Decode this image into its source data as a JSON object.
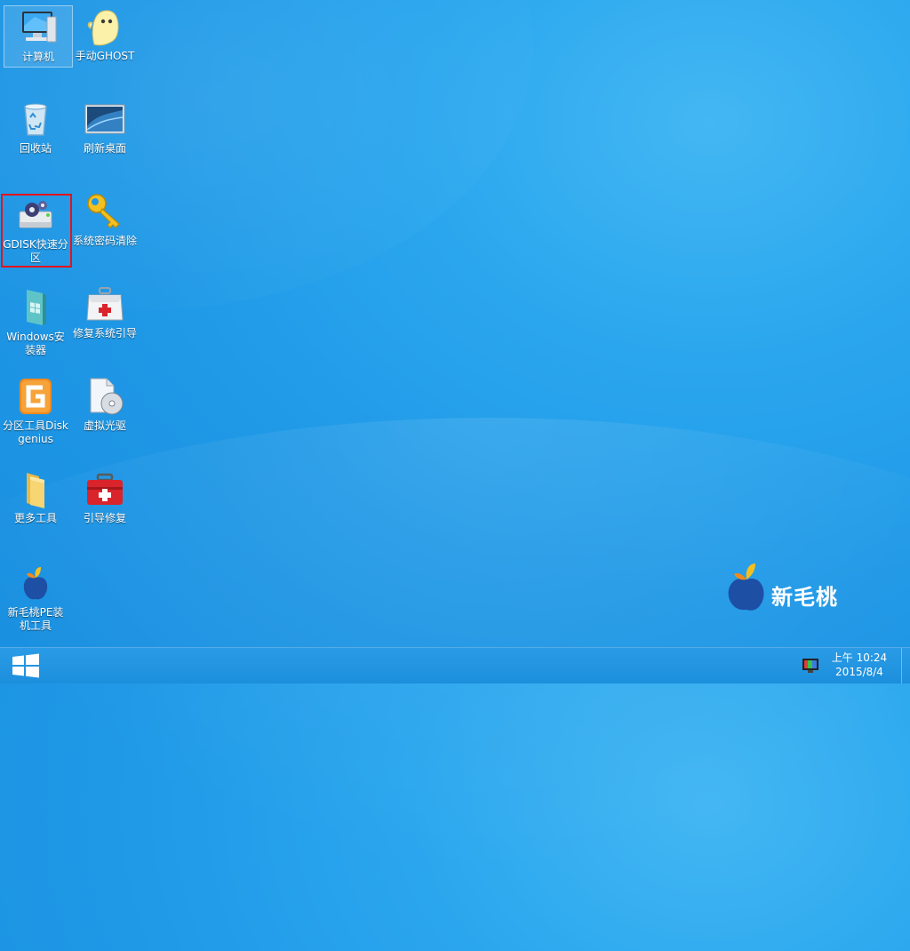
{
  "desktop": {
    "icons": [
      {
        "label": "计算机",
        "icon": "computer-icon"
      },
      {
        "label": "手动GHOST",
        "icon": "ghost-icon"
      },
      {
        "label": "回收站",
        "icon": "recycle-bin-icon"
      },
      {
        "label": "刷新桌面",
        "icon": "refresh-desktop-icon"
      },
      {
        "label": "GDISK快速分区",
        "icon": "gdisk-icon"
      },
      {
        "label": "系统密码清除",
        "icon": "key-icon"
      },
      {
        "label": "Windows安装器",
        "icon": "windows-installer-icon"
      },
      {
        "label": "修复系统引导",
        "icon": "first-aid-kit-icon"
      },
      {
        "label": "分区工具Diskgenius",
        "icon": "diskgenius-icon"
      },
      {
        "label": "虚拟光驱",
        "icon": "virtual-drive-icon"
      },
      {
        "label": "更多工具",
        "icon": "folder-icon"
      },
      {
        "label": "引导修复",
        "icon": "red-toolbox-icon"
      },
      {
        "label": "新毛桃PE装机工具",
        "icon": "peach-installer-icon"
      }
    ]
  },
  "brand": {
    "text": "新毛桃"
  },
  "taskbar": {
    "start_icon": "windows-start-icon",
    "tray_icon": "monitor-color-icon",
    "clock_time": "上午 10:24",
    "clock_date": "2015/8/4"
  },
  "colors": {
    "wallpaper": "#1f98e6",
    "taskbar": "#1c8fdc",
    "highlight_box": "#e3141c"
  }
}
